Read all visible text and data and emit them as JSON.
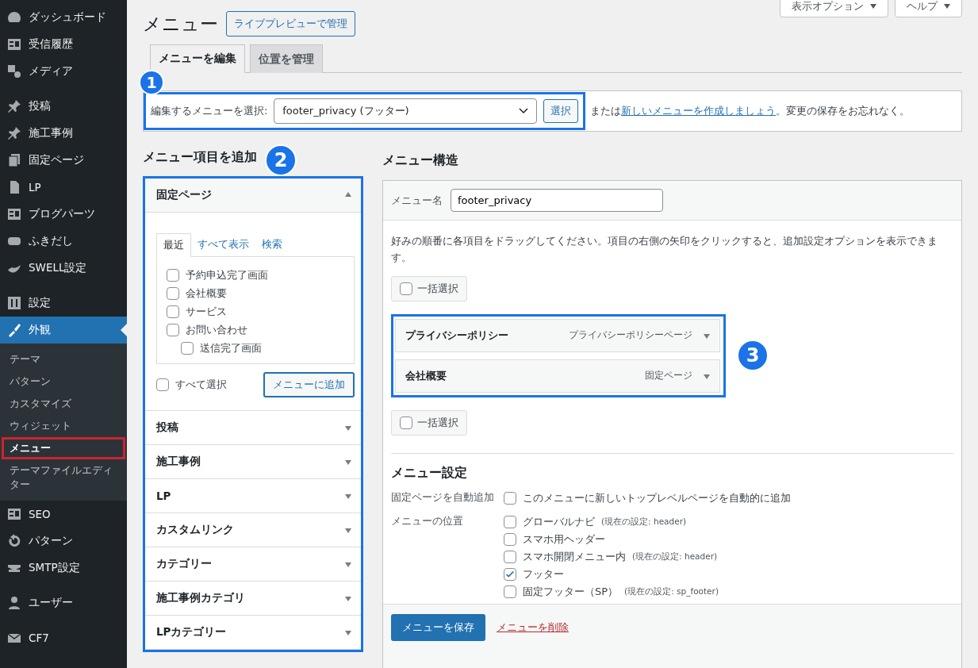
{
  "sidebar": {
    "groups": [
      [
        {
          "label": "ダッシュボード",
          "selected": false
        },
        {
          "label": "受信履歴",
          "selected": false
        },
        {
          "label": "メディア",
          "selected": false
        }
      ],
      [
        {
          "label": "投稿",
          "selected": false
        },
        {
          "label": "施工事例",
          "selected": false
        },
        {
          "label": "固定ページ",
          "selected": false
        },
        {
          "label": "LP",
          "selected": false
        },
        {
          "label": "ブログパーツ",
          "selected": false
        },
        {
          "label": "ふきだし",
          "selected": false
        },
        {
          "label": "SWELL設定",
          "selected": false
        }
      ],
      [
        {
          "label": "設定",
          "selected": false
        },
        {
          "label": "外観",
          "selected": true,
          "children": [
            {
              "label": "テーマ",
              "selected": false,
              "highlighted": false
            },
            {
              "label": "パターン",
              "selected": false,
              "highlighted": false
            },
            {
              "label": "カスタマイズ",
              "selected": false,
              "highlighted": false
            },
            {
              "label": "ウィジェット",
              "selected": false,
              "highlighted": false
            },
            {
              "label": "メニュー",
              "selected": true,
              "highlighted": true
            },
            {
              "label": "テーマファイルエディター",
              "selected": false,
              "highlighted": false
            }
          ]
        },
        {
          "label": "SEO",
          "selected": false
        },
        {
          "label": "パターン",
          "selected": false
        },
        {
          "label": "SMTP設定",
          "selected": false
        }
      ],
      [
        {
          "label": "ユーザー",
          "selected": false
        }
      ],
      [
        {
          "label": "CF7",
          "selected": false
        }
      ]
    ]
  },
  "top_buttons": [
    "表示オプション",
    "ヘルプ"
  ],
  "page_title": "メニュー",
  "live_preview_button": "ライブプレビューで管理",
  "tabs": [
    {
      "label": "メニューを編集",
      "selected": true
    },
    {
      "label": "位置を管理",
      "selected": false
    }
  ],
  "callouts": [
    "1",
    "2",
    "3"
  ],
  "select_bar": {
    "label": "編集するメニューを選択:",
    "value": "footer_privacy (フッター)",
    "button": "選択",
    "text_before": "または",
    "link": "新しいメニューを作成しましょう",
    "text_after": "。変更の保存をお忘れなく。"
  },
  "add_items": {
    "title": "メニュー項目を追加",
    "sections": [
      {
        "title": "固定ページ",
        "expanded": true,
        "tabs": [
          {
            "label": "最近",
            "selected": true
          },
          {
            "label": "すべて表示",
            "selected": false
          },
          {
            "label": "検索",
            "selected": false
          }
        ],
        "pages": [
          {
            "label": "予約申込完了画面",
            "checked": false
          },
          {
            "label": "会社概要",
            "checked": false
          },
          {
            "label": "サービス",
            "checked": false
          },
          {
            "label": "お問い合わせ",
            "checked": false,
            "children": [
              {
                "label": "送信完了画面",
                "checked": false
              }
            ]
          }
        ],
        "select_all": {
          "label": "すべて選択",
          "checked": false
        },
        "add_button": "メニューに追加"
      },
      {
        "title": "投稿",
        "expanded": false
      },
      {
        "title": "施工事例",
        "expanded": false
      },
      {
        "title": "LP",
        "expanded": false
      },
      {
        "title": "カスタムリンク",
        "expanded": false
      },
      {
        "title": "カテゴリー",
        "expanded": false
      },
      {
        "title": "施工事例カテゴリ",
        "expanded": false
      },
      {
        "title": "LPカテゴリー",
        "expanded": false
      }
    ]
  },
  "structure": {
    "title": "メニュー構造",
    "name_label": "メニュー名",
    "name_value": "footer_privacy",
    "instructions": "好みの順番に各項目をドラッグしてください。項目の右側の矢印をクリックすると、追加設定オプションを表示できます。",
    "bulk_select": [
      {
        "label": "一括選択",
        "checked": false
      },
      {
        "label": "一括選択",
        "checked": false
      }
    ],
    "items": [
      {
        "title": "プライバシーポリシー",
        "type": "プライバシーポリシーページ"
      },
      {
        "title": "会社概要",
        "type": "固定ページ"
      }
    ],
    "settings_title": "メニュー設定",
    "auto_add": {
      "label": "固定ページを自動追加",
      "option": "このメニューに新しいトップレベルページを自動的に追加",
      "checked": false
    },
    "locations_label": "メニューの位置",
    "locations": [
      {
        "label": "グローバルナビ",
        "note": "(現在の設定: header)",
        "checked": false
      },
      {
        "label": "スマホ用ヘッダー",
        "checked": false
      },
      {
        "label": "スマホ開閉メニュー内",
        "note": "(現在の設定: header)",
        "checked": false
      },
      {
        "label": "フッター",
        "checked": true
      },
      {
        "label": "固定フッター（SP）",
        "note": "(現在の設定: sp_footer)",
        "checked": false
      }
    ],
    "save_button": "メニューを保存",
    "delete_link": "メニューを削除"
  }
}
